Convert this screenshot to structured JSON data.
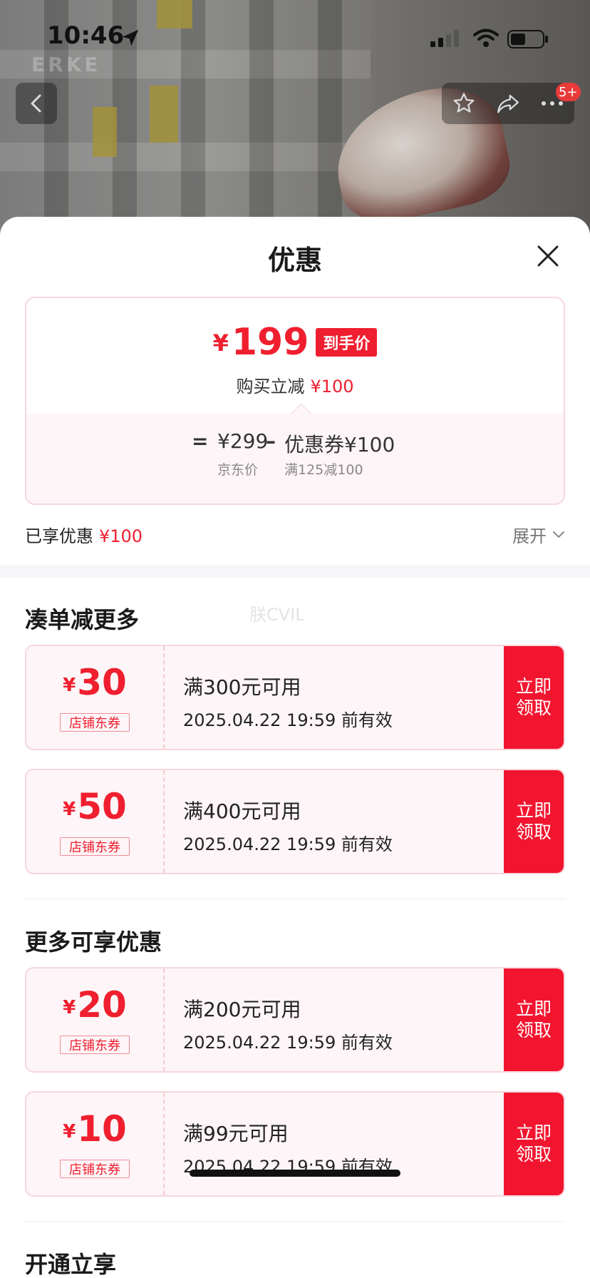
{
  "status_bar": {
    "time": "10:46"
  },
  "header": {
    "brand_text": "ERKE",
    "badge": "5+"
  },
  "sheet": {
    "title": "优惠",
    "price": {
      "currency": "¥",
      "amount": "199",
      "tag": "到手价",
      "subtitle": "购买立减",
      "subtitle_value": "¥100"
    },
    "breakdown": {
      "eq": "=",
      "jd_price": "¥299",
      "minus": "–",
      "coupon_value": "优惠券¥100",
      "jd_price_label": "京东价",
      "coupon_rule": "满125减100"
    },
    "enjoyed_label": "已享优惠",
    "enjoyed_value": "¥100",
    "expand_label": "展开",
    "watermark": "朕CVIL"
  },
  "sections": [
    {
      "title": "凑单减更多",
      "coupons": [
        {
          "currency": "¥",
          "amount": "30",
          "type": "店铺东券",
          "condition": "满300元可用",
          "valid": "2025.04.22 19:59 前有效",
          "claim": "立即领取"
        },
        {
          "currency": "¥",
          "amount": "50",
          "type": "店铺东券",
          "condition": "满400元可用",
          "valid": "2025.04.22 19:59 前有效",
          "claim": "立即领取"
        }
      ]
    },
    {
      "title": "更多可享优惠",
      "coupons": [
        {
          "currency": "¥",
          "amount": "20",
          "type": "店铺东券",
          "condition": "满200元可用",
          "valid": "2025.04.22 19:59 前有效",
          "claim": "立即领取"
        },
        {
          "currency": "¥",
          "amount": "10",
          "type": "店铺东券",
          "condition": "满99元可用",
          "valid": "2025.04.22 19:59 前有效",
          "claim": "立即领取"
        }
      ]
    },
    {
      "title": "开通立享"
    }
  ],
  "colors": {
    "accent_red": "#ef1f2f",
    "claim_red": "#f2152f",
    "coupon_bg": "#fdf5f7",
    "coupon_border": "#f6d7dc"
  },
  "icons": [
    "location-arrow-icon",
    "signal-icon",
    "wifi-icon",
    "battery-icon",
    "back-chevron-icon",
    "star-icon",
    "share-icon",
    "more-icon",
    "close-icon",
    "chevron-down-icon"
  ]
}
